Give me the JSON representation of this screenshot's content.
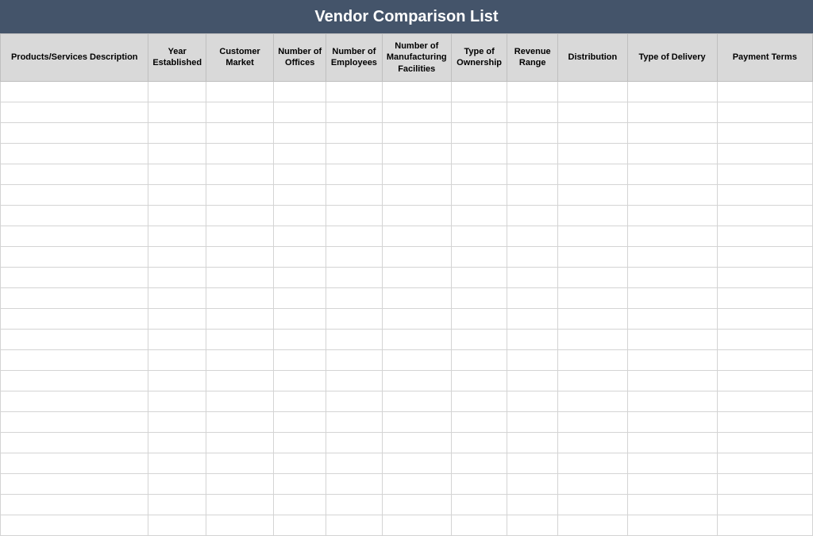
{
  "title": "Vendor Comparison List",
  "columns": [
    "Products/Services Description",
    "Year Established",
    "Customer Market",
    "Number of Offices",
    "Number of Employees",
    "Number of Manufacturing Facilities",
    "Type of Ownership",
    "Revenue Range",
    "Distribution",
    "Type of Delivery",
    "Payment Terms"
  ],
  "rows": [
    [
      "",
      "",
      "",
      "",
      "",
      "",
      "",
      "",
      "",
      "",
      ""
    ],
    [
      "",
      "",
      "",
      "",
      "",
      "",
      "",
      "",
      "",
      "",
      ""
    ],
    [
      "",
      "",
      "",
      "",
      "",
      "",
      "",
      "",
      "",
      "",
      ""
    ],
    [
      "",
      "",
      "",
      "",
      "",
      "",
      "",
      "",
      "",
      "",
      ""
    ],
    [
      "",
      "",
      "",
      "",
      "",
      "",
      "",
      "",
      "",
      "",
      ""
    ],
    [
      "",
      "",
      "",
      "",
      "",
      "",
      "",
      "",
      "",
      "",
      ""
    ],
    [
      "",
      "",
      "",
      "",
      "",
      "",
      "",
      "",
      "",
      "",
      ""
    ],
    [
      "",
      "",
      "",
      "",
      "",
      "",
      "",
      "",
      "",
      "",
      ""
    ],
    [
      "",
      "",
      "",
      "",
      "",
      "",
      "",
      "",
      "",
      "",
      ""
    ],
    [
      "",
      "",
      "",
      "",
      "",
      "",
      "",
      "",
      "",
      "",
      ""
    ],
    [
      "",
      "",
      "",
      "",
      "",
      "",
      "",
      "",
      "",
      "",
      ""
    ],
    [
      "",
      "",
      "",
      "",
      "",
      "",
      "",
      "",
      "",
      "",
      ""
    ],
    [
      "",
      "",
      "",
      "",
      "",
      "",
      "",
      "",
      "",
      "",
      ""
    ],
    [
      "",
      "",
      "",
      "",
      "",
      "",
      "",
      "",
      "",
      "",
      ""
    ],
    [
      "",
      "",
      "",
      "",
      "",
      "",
      "",
      "",
      "",
      "",
      ""
    ],
    [
      "",
      "",
      "",
      "",
      "",
      "",
      "",
      "",
      "",
      "",
      ""
    ],
    [
      "",
      "",
      "",
      "",
      "",
      "",
      "",
      "",
      "",
      "",
      ""
    ],
    [
      "",
      "",
      "",
      "",
      "",
      "",
      "",
      "",
      "",
      "",
      ""
    ],
    [
      "",
      "",
      "",
      "",
      "",
      "",
      "",
      "",
      "",
      "",
      ""
    ],
    [
      "",
      "",
      "",
      "",
      "",
      "",
      "",
      "",
      "",
      "",
      ""
    ],
    [
      "",
      "",
      "",
      "",
      "",
      "",
      "",
      "",
      "",
      "",
      ""
    ],
    [
      "",
      "",
      "",
      "",
      "",
      "",
      "",
      "",
      "",
      "",
      ""
    ]
  ]
}
